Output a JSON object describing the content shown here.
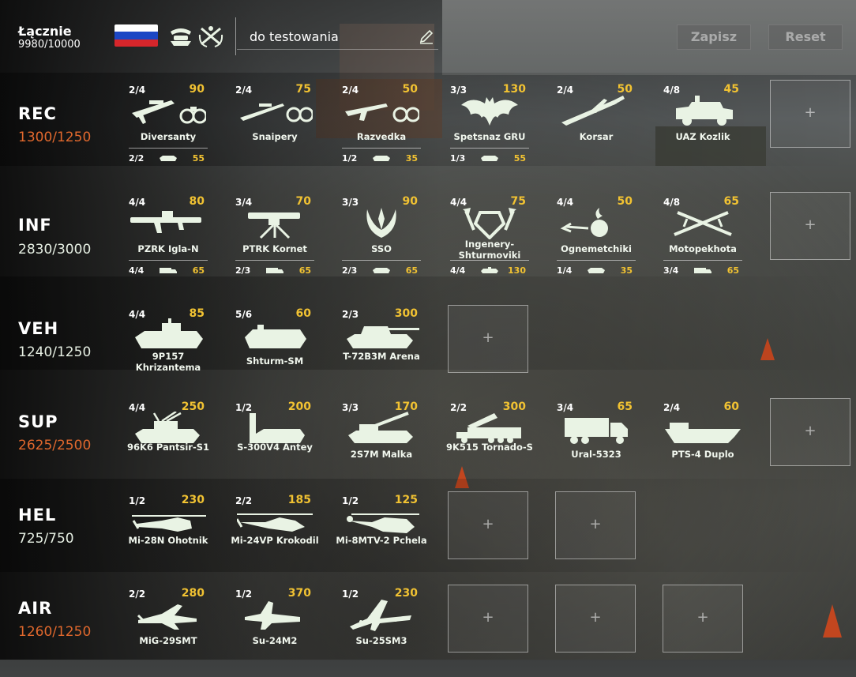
{
  "header": {
    "total_label": "Łącznie",
    "total_value": "9980/10000",
    "flag_icon": "russia-flag",
    "spec_icon_1": "spec-insignia-icon",
    "spec_icon_2": "crossed-rifles-wreath-icon",
    "deck_name": "do testowania",
    "save_label": "Zapisz",
    "reset_label": "Reset"
  },
  "categories": [
    {
      "code": "REC",
      "points": "1300/1250",
      "over": true,
      "units": [
        {
          "avail": "2/4",
          "cost": "90",
          "name": "Diversanty",
          "icon": "rifle-binoculars",
          "t_avail": "2/2",
          "t_cost": "55"
        },
        {
          "avail": "2/4",
          "cost": "75",
          "name": "Snaipery",
          "icon": "sniper-binoculars"
        },
        {
          "avail": "2/4",
          "cost": "50",
          "name": "Razvedka",
          "icon": "ak-binoculars",
          "t_avail": "1/2",
          "t_cost": "35"
        },
        {
          "avail": "3/3",
          "cost": "130",
          "name": "Spetsnaz GRU",
          "icon": "bat-emblem",
          "t_avail": "1/3",
          "t_cost": "55"
        },
        {
          "avail": "2/4",
          "cost": "50",
          "name": "Korsar",
          "icon": "drone"
        },
        {
          "avail": "4/8",
          "cost": "45",
          "name": "UAZ Kozlik",
          "icon": "jeep"
        }
      ]
    },
    {
      "code": "INF",
      "points": "2830/3000",
      "over": false,
      "units": [
        {
          "avail": "4/4",
          "cost": "80",
          "name": "PZRK Igla-N",
          "icon": "manpads",
          "t_avail": "4/4",
          "t_cost": "65"
        },
        {
          "avail": "3/4",
          "cost": "70",
          "name": "PTRK Kornet",
          "icon": "atgm-tripod",
          "t_avail": "2/3",
          "t_cost": "65"
        },
        {
          "avail": "3/3",
          "cost": "90",
          "name": "SSO",
          "icon": "sso-emblem",
          "t_avail": "2/3",
          "t_cost": "65"
        },
        {
          "avail": "4/4",
          "cost": "75",
          "name": "Ingenery-Shturmoviki",
          "icon": "engineer-shield",
          "t_avail": "4/4",
          "t_cost": "130"
        },
        {
          "avail": "4/4",
          "cost": "50",
          "name": "Ognemetchiki",
          "icon": "flame-grenade",
          "t_avail": "1/4",
          "t_cost": "35"
        },
        {
          "avail": "4/8",
          "cost": "65",
          "name": "Motopekhota",
          "icon": "crossed-rifles",
          "t_avail": "3/4",
          "t_cost": "65"
        }
      ]
    },
    {
      "code": "VEH",
      "points": "1240/1250",
      "over": false,
      "units": [
        {
          "avail": "4/4",
          "cost": "85",
          "name": "9P157 Khrizantema",
          "icon": "atgm-vehicle"
        },
        {
          "avail": "5/6",
          "cost": "60",
          "name": "Shturm-SM",
          "icon": "tracked-apc"
        },
        {
          "avail": "2/3",
          "cost": "300",
          "name": "T-72B3M Arena",
          "icon": "tank"
        }
      ]
    },
    {
      "code": "SUP",
      "points": "2625/2500",
      "over": true,
      "units": [
        {
          "avail": "4/4",
          "cost": "250",
          "name": "96K6 Pantsir-S1",
          "icon": "aa-vehicle"
        },
        {
          "avail": "1/2",
          "cost": "200",
          "name": "S-300V4 Antey",
          "icon": "sam-launcher"
        },
        {
          "avail": "3/3",
          "cost": "170",
          "name": "2S7M Malka",
          "icon": "spg-artillery"
        },
        {
          "avail": "2/2",
          "cost": "300",
          "name": "9K515 Tornado-S",
          "icon": "mlrs"
        },
        {
          "avail": "3/4",
          "cost": "65",
          "name": "Ural-5323",
          "icon": "truck"
        },
        {
          "avail": "2/4",
          "cost": "60",
          "name": "PTS-4 Duplo",
          "icon": "amphibious-carrier"
        }
      ]
    },
    {
      "code": "HEL",
      "points": "725/750",
      "over": false,
      "units": [
        {
          "avail": "1/2",
          "cost": "230",
          "name": "Mi-28N Ohotnik",
          "icon": "attack-helicopter"
        },
        {
          "avail": "2/2",
          "cost": "185",
          "name": "Mi-24VP Krokodil",
          "icon": "gunship-helicopter"
        },
        {
          "avail": "1/2",
          "cost": "125",
          "name": "Mi-8MTV-2 Pchela",
          "icon": "transport-helicopter"
        }
      ]
    },
    {
      "code": "AIR",
      "points": "1260/1250",
      "over": true,
      "units": [
        {
          "avail": "2/2",
          "cost": "280",
          "name": "MiG-29SMT",
          "icon": "fighter-jet"
        },
        {
          "avail": "1/2",
          "cost": "370",
          "name": "Su-24M2",
          "icon": "swing-wing-bomber"
        },
        {
          "avail": "1/2",
          "cost": "230",
          "name": "Su-25SM3",
          "icon": "attack-jet"
        }
      ]
    }
  ],
  "empty_slot_symbol": "+",
  "colors": {
    "cost": "#f1c232",
    "over_limit": "#e0682d",
    "text": "#e9f3e4"
  }
}
